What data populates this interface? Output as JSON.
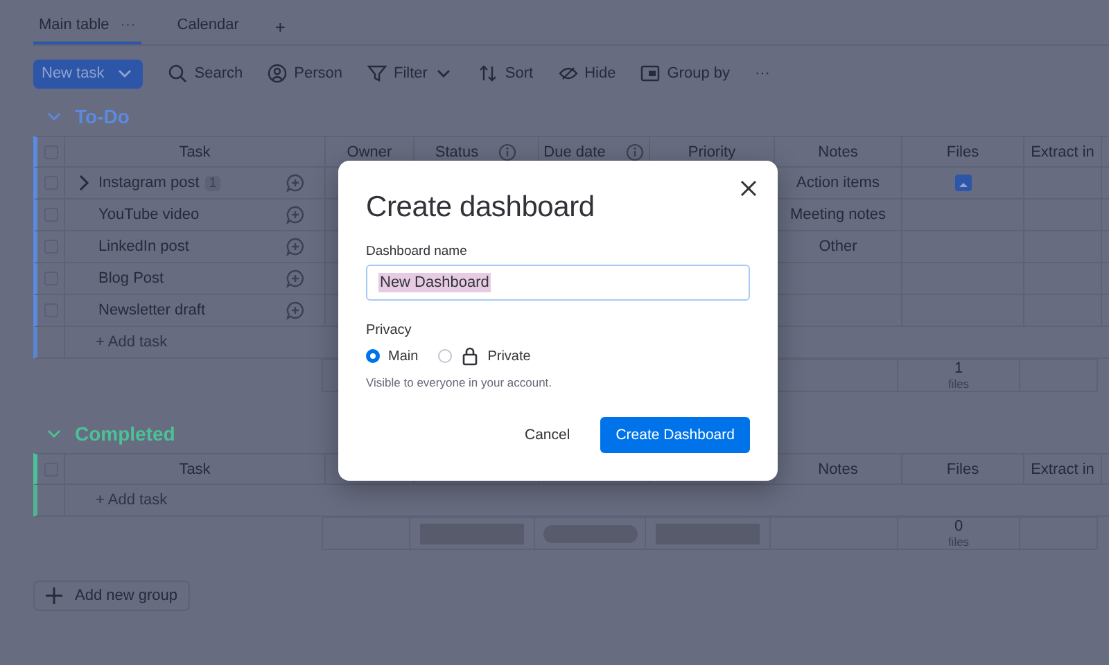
{
  "tabs": [
    {
      "label": "Main table",
      "selected": true,
      "menu": "···"
    },
    {
      "label": "Calendar",
      "selected": false
    }
  ],
  "add_view": "+",
  "toolbar": {
    "new_task": "New task",
    "items": [
      {
        "kind": "search",
        "label": "Search",
        "dropdown": false
      },
      {
        "kind": "person",
        "label": "Person",
        "dropdown": false
      },
      {
        "kind": "filter",
        "label": "Filter",
        "dropdown": true
      },
      {
        "kind": "sort",
        "label": "Sort",
        "dropdown": false
      },
      {
        "kind": "hide",
        "label": "Hide",
        "dropdown": false
      },
      {
        "kind": "group",
        "label": "Group by",
        "dropdown": false
      }
    ],
    "more": "···"
  },
  "groups": [
    {
      "title": "To-Do",
      "color": "#5b8ae0",
      "all_checked": false,
      "columns": [
        {
          "label": "Task",
          "info": false
        },
        {
          "label": "Owner",
          "info": false
        },
        {
          "label": "Status",
          "info": true
        },
        {
          "label": "Due date",
          "info": true
        },
        {
          "label": "Priority",
          "info": false
        },
        {
          "label": "Notes",
          "info": false
        },
        {
          "label": "Files",
          "info": false
        },
        {
          "label": "Extract in",
          "info": false
        }
      ],
      "rows": [
        {
          "task": "Instagram post",
          "checked": false,
          "expandable": true,
          "subitems": "1",
          "notes": "Action items",
          "file": true
        },
        {
          "task": "YouTube video",
          "checked": false,
          "expandable": false,
          "notes": "Meeting notes",
          "file": false
        },
        {
          "task": "LinkedIn post",
          "checked": false,
          "expandable": false,
          "notes": "Other",
          "file": false
        },
        {
          "task": "Blog Post",
          "checked": false,
          "expandable": false,
          "file": false
        },
        {
          "task": "Newsletter draft",
          "checked": false,
          "expandable": false,
          "file": false
        }
      ],
      "add_task": "+ Add task",
      "summary": {
        "bars": false,
        "files_count": "1",
        "files_unit": "files"
      }
    },
    {
      "title": "Completed",
      "color": "#4cc196",
      "all_checked": false,
      "columns": [
        {
          "label": "Task",
          "info": false
        },
        {
          "label": "Notes",
          "info": false
        },
        {
          "label": "Files",
          "info": false
        },
        {
          "label": "Extract in",
          "info": false
        }
      ],
      "add_task": "+ Add task",
      "summary": {
        "bars": true,
        "files_count": "0",
        "files_unit": "files"
      }
    }
  ],
  "add_group": "Add new group",
  "dialog": {
    "title": "Create dashboard",
    "name_label": "Dashboard name",
    "name_value": "New Dashboard",
    "value_selected": true,
    "privacy_label": "Privacy",
    "options": [
      {
        "label": "Main",
        "selected": true,
        "locked": false
      },
      {
        "label": "Private",
        "selected": false,
        "locked": true
      }
    ],
    "hint": "Visible to everyone in your account.",
    "cancel": "Cancel",
    "confirm": "Create Dashboard"
  }
}
